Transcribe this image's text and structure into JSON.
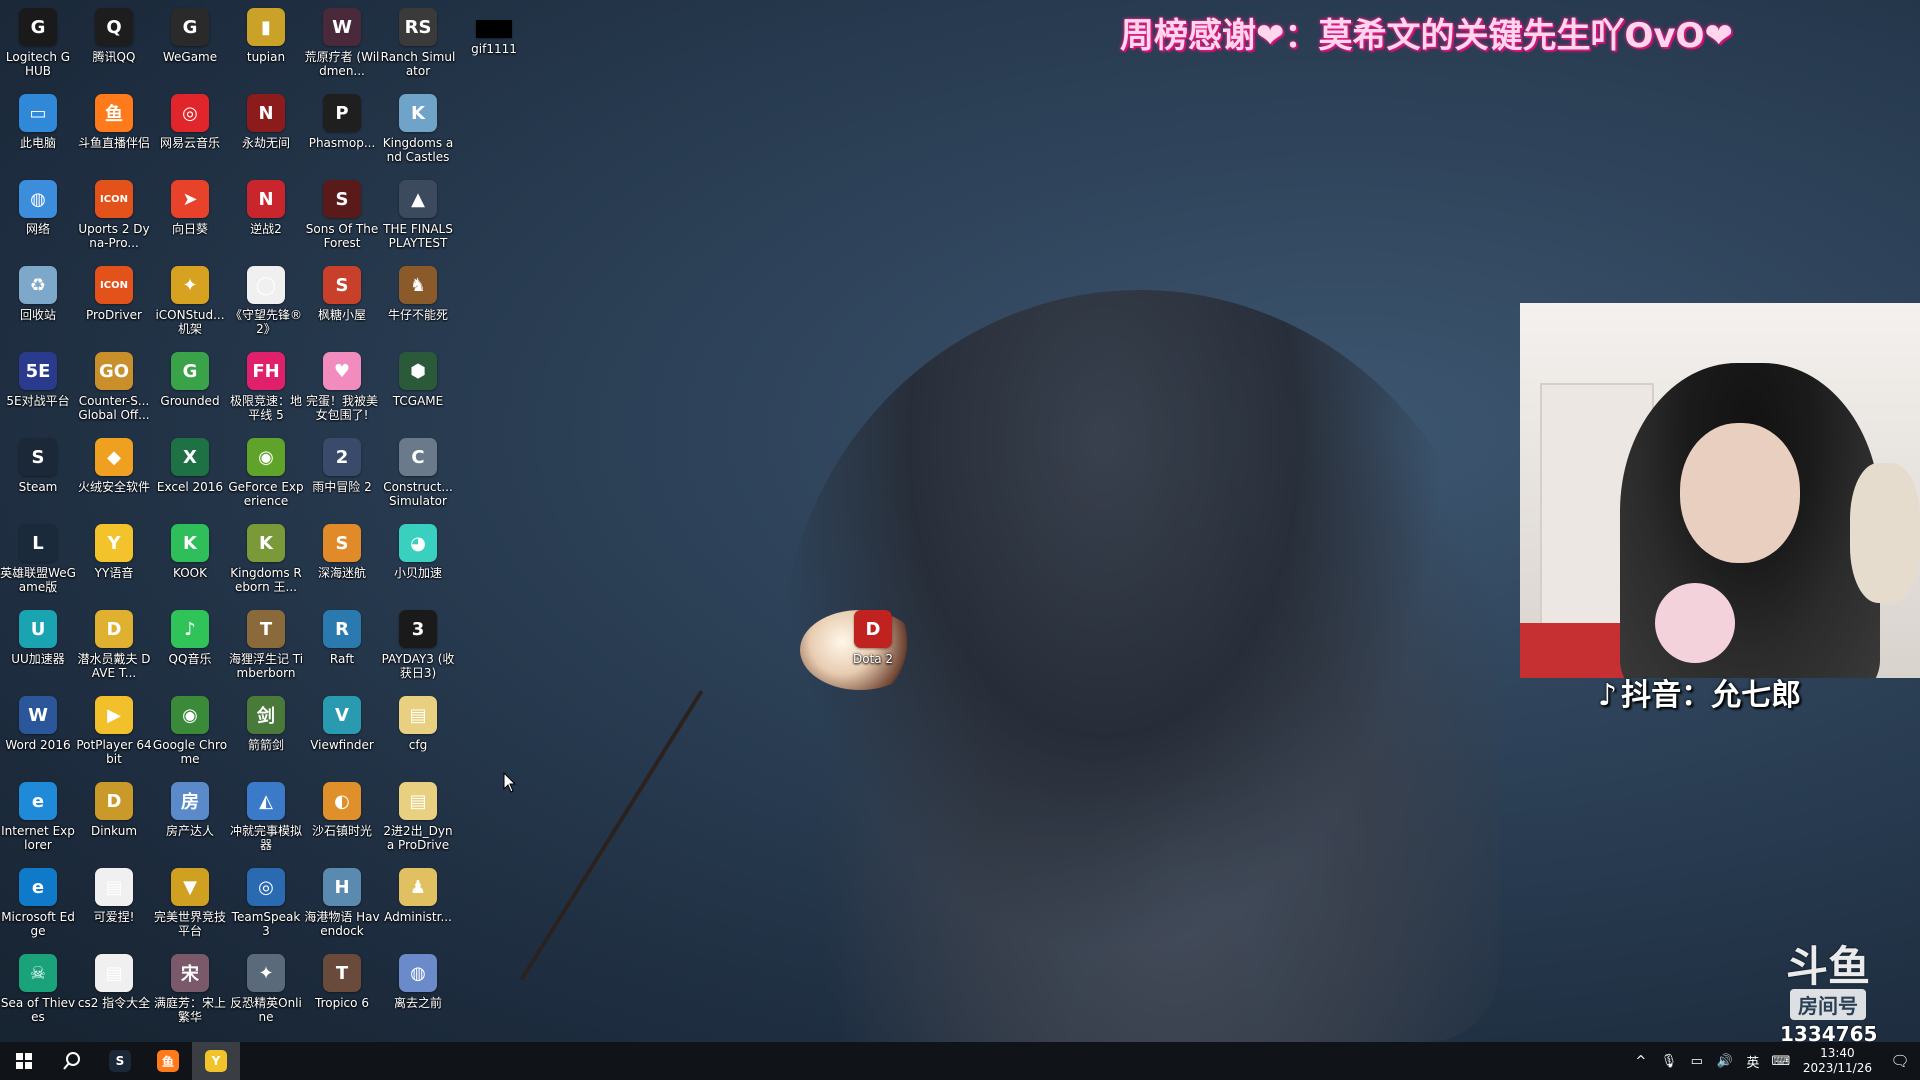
{
  "banner": {
    "text": "周榜感谢❤：莫希文的关键先生吖OvO❤"
  },
  "douyin": {
    "icon": "douyin-note-icon",
    "text": "抖音：允七郎"
  },
  "douyu": {
    "logo": "斗鱼",
    "room_label": "房间号",
    "room_number": "1334765"
  },
  "desktop": {
    "icons": [
      {
        "label": "Logitech G HUB",
        "glyph": "G",
        "color": "#1a1a1a"
      },
      {
        "label": "腾讯QQ",
        "glyph": "Q",
        "color": "#1d1d1d"
      },
      {
        "label": "WeGame",
        "glyph": "G",
        "color": "#2a2a2a"
      },
      {
        "label": "tupian",
        "glyph": "▮",
        "color": "#c9a227"
      },
      {
        "label": "荒原疗者 (Wildmen...",
        "glyph": "W",
        "color": "#4a2a3a"
      },
      {
        "label": "Ranch Simulator",
        "glyph": "RS",
        "color": "#3a3a3a"
      },
      {
        "label": "gif1111",
        "glyph": "",
        "color": "#000000"
      },
      {
        "label": "此电脑",
        "glyph": "▭",
        "color": "#2f88d8"
      },
      {
        "label": "斗鱼直播伴侣",
        "glyph": "鱼",
        "color": "#ff7a1a"
      },
      {
        "label": "网易云音乐",
        "glyph": "◎",
        "color": "#e0262b"
      },
      {
        "label": "永劫无间",
        "glyph": "N",
        "color": "#8c1b1b"
      },
      {
        "label": "Phasmop...",
        "glyph": "P",
        "color": "#1f1f1f"
      },
      {
        "label": "Kingdoms and Castles",
        "glyph": "K",
        "color": "#6fa3c7"
      },
      {
        "label": "网络",
        "glyph": "◍",
        "color": "#3c8ddc"
      },
      {
        "label": "Uports 2 Dyna-Pro...",
        "glyph": "ICON",
        "color": "#e4521c"
      },
      {
        "label": "向日葵",
        "glyph": "➤",
        "color": "#e8432a"
      },
      {
        "label": "逆战2",
        "glyph": "N",
        "color": "#c9252c"
      },
      {
        "label": "Sons Of The Forest",
        "glyph": "S",
        "color": "#5a1a1a"
      },
      {
        "label": "THE FINALS PLAYTEST",
        "glyph": "▲",
        "color": "#3b4a5c"
      },
      {
        "label": "回收站",
        "glyph": "♻",
        "color": "#7ea8c9"
      },
      {
        "label": "ProDriver",
        "glyph": "ICON",
        "color": "#e4521c"
      },
      {
        "label": "iCONStud... 机架",
        "glyph": "✦",
        "color": "#d6a21f"
      },
      {
        "label": "《守望先锋®2》",
        "glyph": "◯",
        "color": "#f0f0f0"
      },
      {
        "label": "枫糖小屋",
        "glyph": "S",
        "color": "#c9402a"
      },
      {
        "label": "牛仔不能死",
        "glyph": "♞",
        "color": "#8a5a2a"
      },
      {
        "label": "5E对战平台",
        "glyph": "5E",
        "color": "#2a3a8c"
      },
      {
        "label": "Counter-S... Global Off...",
        "glyph": "GO",
        "color": "#c98f2a"
      },
      {
        "label": "Grounded",
        "glyph": "G",
        "color": "#3aa34a"
      },
      {
        "label": "极限竞速：地平线 5",
        "glyph": "FH",
        "color": "#e0206a"
      },
      {
        "label": "完蛋！我被美女包围了!",
        "glyph": "♥",
        "color": "#f28cbf"
      },
      {
        "label": "TCGAME",
        "glyph": "⬢",
        "color": "#2a5a3a"
      },
      {
        "label": "Steam",
        "glyph": "S",
        "color": "#1b2838"
      },
      {
        "label": "火绒安全软件",
        "glyph": "◆",
        "color": "#f0a020"
      },
      {
        "label": "Excel 2016",
        "glyph": "X",
        "color": "#1e7145"
      },
      {
        "label": "GeForce Experience",
        "glyph": "◉",
        "color": "#5fa32a"
      },
      {
        "label": "雨中冒险 2",
        "glyph": "2",
        "color": "#3a4a6a"
      },
      {
        "label": "Construct... Simulator",
        "glyph": "C",
        "color": "#6a7a8a"
      },
      {
        "label": "英雄联盟WeGame版",
        "glyph": "L",
        "color": "#1a2a3a"
      },
      {
        "label": "YY语音",
        "glyph": "Y",
        "color": "#f2c32a"
      },
      {
        "label": "KOOK",
        "glyph": "K",
        "color": "#2fbf5a"
      },
      {
        "label": "Kingdoms Reborn 王...",
        "glyph": "K",
        "color": "#7a9a3a"
      },
      {
        "label": "深海迷航",
        "glyph": "S",
        "color": "#e08a2a"
      },
      {
        "label": "小贝加速",
        "glyph": "◕",
        "color": "#3ad0c0"
      },
      {
        "label": "UU加速器",
        "glyph": "U",
        "color": "#1aa3b0"
      },
      {
        "label": "潜水员戴夫 DAVE T...",
        "glyph": "D",
        "color": "#e0b030"
      },
      {
        "label": "QQ音乐",
        "glyph": "♪",
        "color": "#2fc35a"
      },
      {
        "label": "海狸浮生记 Timberborn",
        "glyph": "T",
        "color": "#8a6a3a"
      },
      {
        "label": "Raft",
        "glyph": "R",
        "color": "#2a7ab0"
      },
      {
        "label": "PAYDAY3 (收获日3)",
        "glyph": "3",
        "color": "#1a1a1a"
      },
      {
        "label": "Word 2016",
        "glyph": "W",
        "color": "#2b579a"
      },
      {
        "label": "PotPlayer 64 bit",
        "glyph": "▶",
        "color": "#f2c02a"
      },
      {
        "label": "Google Chrome",
        "glyph": "◉",
        "color": "#3a8a3a"
      },
      {
        "label": "箭箭剑",
        "glyph": "剑",
        "color": "#4a7a3a"
      },
      {
        "label": "Viewfinder",
        "glyph": "V",
        "color": "#2a9ab0"
      },
      {
        "label": "cfg",
        "glyph": "▤",
        "color": "#e8d080"
      },
      {
        "label": "Internet Explorer",
        "glyph": "e",
        "color": "#1f8ad8"
      },
      {
        "label": "Dinkum",
        "glyph": "D",
        "color": "#c99a2a"
      },
      {
        "label": "房产达人",
        "glyph": "房",
        "color": "#5a8ac9"
      },
      {
        "label": "冲就完事模拟器",
        "glyph": "◭",
        "color": "#3a7ac9"
      },
      {
        "label": "沙石镇时光",
        "glyph": "◐",
        "color": "#e0902a"
      },
      {
        "label": "2进2出_Dyna ProDrive 4...",
        "glyph": "▤",
        "color": "#e8d080"
      },
      {
        "label": "Microsoft Edge",
        "glyph": "e",
        "color": "#0f7ac9"
      },
      {
        "label": "可爱捏!",
        "glyph": "▤",
        "color": "#f0f0f0"
      },
      {
        "label": "完美世界竞技平台",
        "glyph": "▼",
        "color": "#d0a020"
      },
      {
        "label": "TeamSpeak 3",
        "glyph": "◎",
        "color": "#2a6ab0"
      },
      {
        "label": "海港物语 Havendock",
        "glyph": "H",
        "color": "#5a8ab0"
      },
      {
        "label": "Administr...",
        "glyph": "♟",
        "color": "#e0c060"
      },
      {
        "label": "Sea of Thieves",
        "glyph": "☠",
        "color": "#1aa37a"
      },
      {
        "label": "cs2 指令大全",
        "glyph": "▤",
        "color": "#f0f0f0"
      },
      {
        "label": "满庭芳：宋上繁华",
        "glyph": "宋",
        "color": "#7a5a6a"
      },
      {
        "label": "反恐精英Online",
        "glyph": "✦",
        "color": "#5a6a7a"
      },
      {
        "label": "Tropico 6",
        "glyph": "T",
        "color": "#6a4a3a"
      },
      {
        "label": "离去之前",
        "glyph": "◍",
        "color": "#6a8ac9"
      },
      {
        "label": "Dota 2",
        "glyph": "D",
        "color": "#c0221f"
      }
    ]
  },
  "taskbar": {
    "start": "start-icon",
    "search": "search-icon",
    "pinned": [
      {
        "name": "steam",
        "glyph": "S",
        "color": "#1b2838"
      },
      {
        "name": "douyu",
        "glyph": "鱼",
        "color": "#ff7a1a"
      },
      {
        "name": "yy",
        "glyph": "Y",
        "color": "#f2c32a"
      }
    ],
    "tray": {
      "chevron": "^",
      "mic": "🎙",
      "network": "▭",
      "volume": "🔊",
      "ime": "英",
      "keyboard": "⌨",
      "time": "13:40",
      "date": "2023/11/26",
      "notifications": "🗨"
    }
  }
}
